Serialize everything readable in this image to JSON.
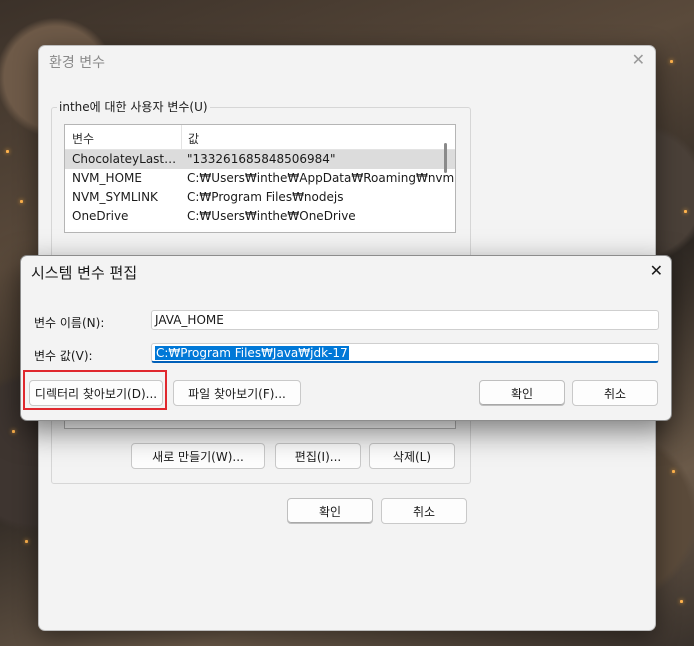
{
  "env_window": {
    "title": "환경 변수",
    "user_vars_label": "inthe에 대한 사용자 변수(U)",
    "columns": [
      "변수",
      "값"
    ],
    "rows": [
      {
        "name": "ChocolateyLastPat...",
        "value": "\"133261685848506984\""
      },
      {
        "name": "NVM_HOME",
        "value": "C:₩Users₩inthe₩AppData₩Roaming₩nvm"
      },
      {
        "name": "NVM_SYMLINK",
        "value": "C:₩Program Files₩nodejs"
      },
      {
        "name": "OneDrive",
        "value": "C:₩Users₩inthe₩OneDrive"
      }
    ],
    "system_buttons": {
      "new": "새로 만들기(W)...",
      "edit": "편집(I)...",
      "delete": "삭제(L)"
    },
    "ok": "확인",
    "cancel": "취소"
  },
  "edit_dialog": {
    "title": "시스템 변수 편집",
    "name_label": "변수 이름(N):",
    "name_value": "JAVA_HOME",
    "value_label": "변수 값(V):",
    "value_value": "C:₩Program Files₩Java₩jdk-17",
    "browse_dir": "디렉터리 찾아보기(D)...",
    "browse_file": "파일 찾아보기(F)...",
    "ok": "확인",
    "cancel": "취소"
  },
  "colors": {
    "selection": "#0078d7",
    "highlight_border": "#e0282e"
  }
}
